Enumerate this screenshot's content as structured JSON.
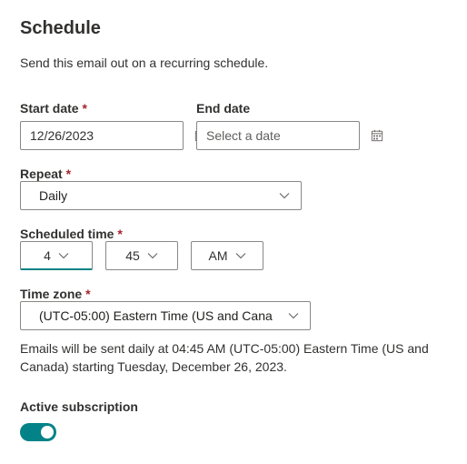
{
  "title": "Schedule",
  "description": "Send this email out on a recurring schedule.",
  "startDate": {
    "label": "Start date",
    "value": "12/26/2023"
  },
  "endDate": {
    "label": "End date",
    "placeholder": "Select a date"
  },
  "repeat": {
    "label": "Repeat",
    "value": "Daily"
  },
  "scheduledTime": {
    "label": "Scheduled time",
    "hour": "4",
    "minute": "45",
    "meridiem": "AM"
  },
  "timezone": {
    "label": "Time zone",
    "value": "(UTC-05:00) Eastern Time (US and Cana"
  },
  "summary": "Emails will be sent daily at 04:45 AM (UTC-05:00) Eastern Time (US and Canada) starting Tuesday, December 26, 2023.",
  "activeSubscription": {
    "label": "Active subscription",
    "enabled": true
  }
}
